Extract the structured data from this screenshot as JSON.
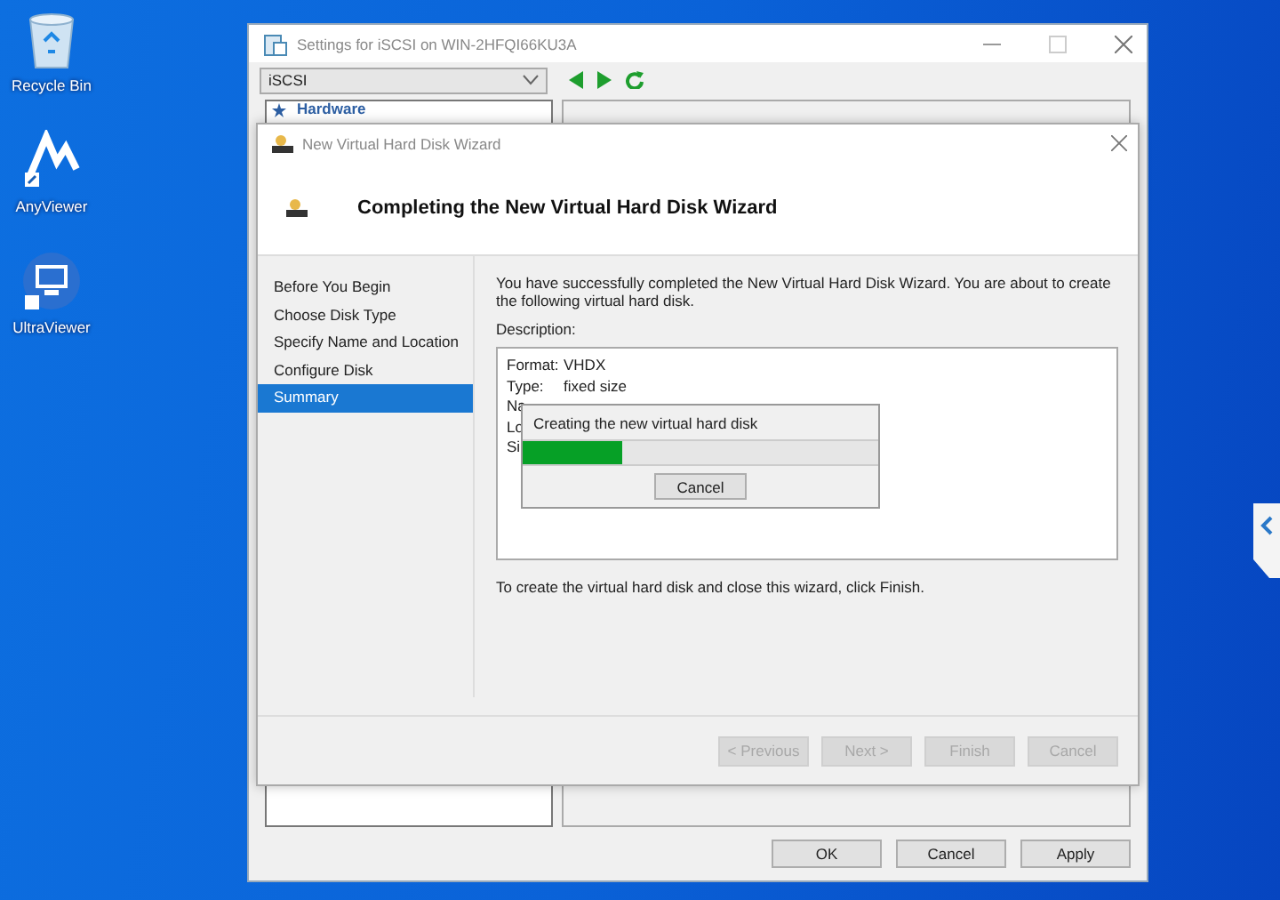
{
  "desktop_icons": [
    {
      "label": "Recycle Bin",
      "kind": "recycle"
    },
    {
      "label": "AnyViewer",
      "kind": "anyviewer"
    },
    {
      "label": "UltraViewer",
      "kind": "ultraviewer"
    }
  ],
  "settings_window": {
    "title": "Settings for iSCSI on WIN-2HFQI66KU3A",
    "selector": "iSCSI",
    "tree_item": "Hardware",
    "buttons": [
      {
        "label": "OK"
      },
      {
        "label": "Cancel"
      },
      {
        "label": "Apply"
      }
    ]
  },
  "wizard": {
    "title": "New Virtual Hard Disk Wizard",
    "heading": "Completing the New Virtual Hard Disk Wizard",
    "steps": [
      {
        "label": "Before You Begin",
        "selected": false
      },
      {
        "label": "Choose Disk Type",
        "selected": false
      },
      {
        "label": "Specify Name and Location",
        "selected": false
      },
      {
        "label": "Configure Disk",
        "selected": false
      },
      {
        "label": "Summary",
        "selected": true
      }
    ],
    "intro": "You have successfully completed the New Virtual Hard Disk Wizard. You are about to create the following virtual hard disk.",
    "description_label": "Description:",
    "description": [
      {
        "label": "Format:",
        "value": "VHDX"
      },
      {
        "label": "Type:",
        "value": "fixed size"
      },
      {
        "label": "Na"
      },
      {
        "label": "Lo"
      },
      {
        "label": "Si"
      }
    ],
    "progress": {
      "message": "Creating the new virtual hard disk",
      "level": 0.28,
      "button": "Cancel"
    },
    "finish_note": "To create the virtual hard disk and close this wizard, click Finish.",
    "buttons": [
      {
        "label": "< Previous",
        "disabled": true
      },
      {
        "label": "Next >",
        "disabled": true
      },
      {
        "label": "Finish",
        "disabled": true
      },
      {
        "label": "Cancel",
        "disabled": true
      }
    ]
  }
}
